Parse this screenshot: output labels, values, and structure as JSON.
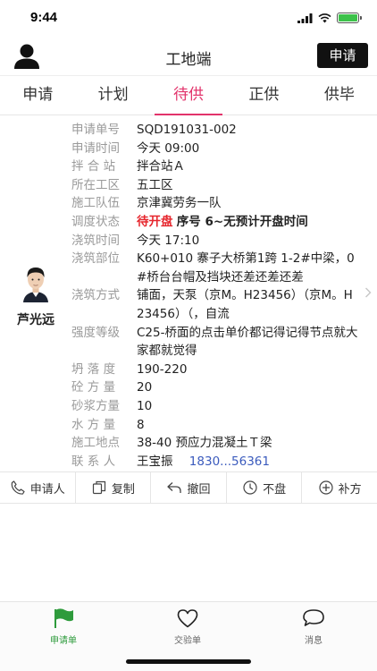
{
  "status_bar": {
    "time": "9:44"
  },
  "header": {
    "title": "工地端",
    "apply_button": "申请"
  },
  "tabs": [
    {
      "label": "申请",
      "active": false
    },
    {
      "label": "计划",
      "active": false
    },
    {
      "label": "待供",
      "active": true
    },
    {
      "label": "正供",
      "active": false
    },
    {
      "label": "供毕",
      "active": false
    }
  ],
  "colors": {
    "accent": "#e2336b",
    "status_red": "#e6262d",
    "phone_blue": "#3b5bbd",
    "tab_active_green": "#2e9b3c"
  },
  "card": {
    "person_name": "芦光远",
    "fields": {
      "order_no": {
        "label": "申请单号",
        "value": "SQD191031-002"
      },
      "apply_time": {
        "label": "申请时间",
        "value": "今天 09:00"
      },
      "mix_station": {
        "label": "拌 合 站",
        "value": "拌合站Ａ"
      },
      "work_area": {
        "label": "所在工区",
        "value": "五工区"
      },
      "team": {
        "label": "施工队伍",
        "value": "京津冀劳务一队"
      },
      "dispatch": {
        "label": "调度状态",
        "status": "待开盘",
        "detail": "序号 6~无预计开盘时间"
      },
      "pour_time": {
        "label": "浇筑时间",
        "value": "今天 17:10"
      },
      "pour_part": {
        "label": "浇筑部位",
        "value": "K60+010 寨子大桥第1跨 1-2#中梁，0#桥台台帽及挡块还差还差还差"
      },
      "pour_method": {
        "label": "浇筑方式",
        "value": "铺面，天泵（京M。H23456）（京M。H23456）（，自流"
      },
      "strength": {
        "label": "强度等级",
        "value": "C25-桥面的点击单价都记得记得节点就大家都就觉得"
      },
      "slump": {
        "label": "坍 落 度",
        "value": "190-220"
      },
      "concrete_qty": {
        "label": "砼 方 量",
        "value": "20"
      },
      "mortar_qty": {
        "label": "砂浆方量",
        "value": "10"
      },
      "water_qty": {
        "label": "水 方 量",
        "value": "8"
      },
      "site": {
        "label": "施工地点",
        "value": "38-40 预应力混凝土Ｔ梁"
      },
      "contact": {
        "label": "联 系 人",
        "name": "王宝振",
        "phone": "1830...56361"
      }
    }
  },
  "actions": [
    {
      "label": "申请人",
      "icon": "phone-icon"
    },
    {
      "label": "复制",
      "icon": "copy-icon"
    },
    {
      "label": "撤回",
      "icon": "undo-icon"
    },
    {
      "label": "不盘",
      "icon": "clock-icon"
    },
    {
      "label": "补方",
      "icon": "plus-circle-icon"
    }
  ],
  "bottom_nav": [
    {
      "label": "申请单",
      "icon": "flag-icon",
      "active": true
    },
    {
      "label": "交验单",
      "icon": "heart-icon",
      "active": false
    },
    {
      "label": "消息",
      "icon": "chat-bubble-icon",
      "active": false
    }
  ]
}
